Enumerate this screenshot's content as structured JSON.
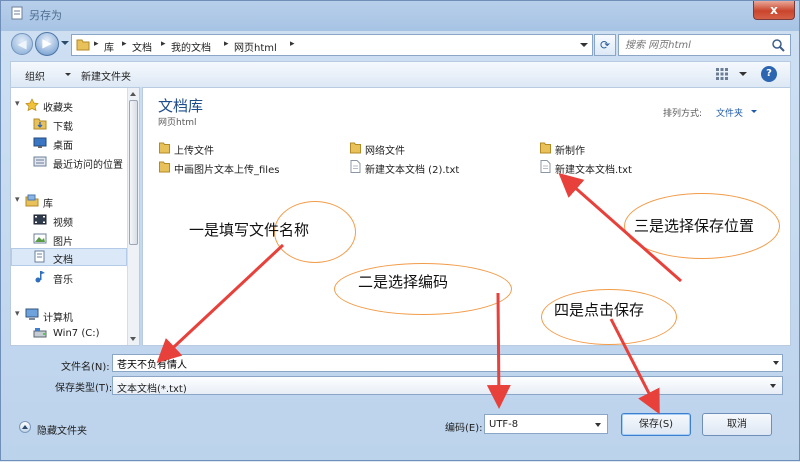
{
  "window": {
    "title": "另存为",
    "close_label": "x"
  },
  "address": {
    "crumbs": [
      "库",
      "文档",
      "我的文档",
      "网页html"
    ],
    "search_placeholder": "搜索 网页html"
  },
  "toolbar": {
    "organize": "组织",
    "new_folder": "新建文件夹",
    "help": "?"
  },
  "nav": {
    "favorites": "收藏夹",
    "downloads": "下载",
    "desktop": "桌面",
    "recent": "最近访问的位置",
    "libraries": "库",
    "videos": "视频",
    "pictures": "图片",
    "documents": "文档",
    "music": "音乐",
    "computer": "计算机",
    "drive_c": "Win7 (C:)"
  },
  "content": {
    "library_title": "文档库",
    "library_subtitle": "网页html",
    "arrange_label": "排列方式:",
    "arrange_value": "文件夹",
    "files": [
      {
        "name": "上传文件",
        "type": "folder"
      },
      {
        "name": "网络文件",
        "type": "folder"
      },
      {
        "name": "新制作",
        "type": "folder"
      },
      {
        "name": "中画图片文本上传_files",
        "type": "folder"
      },
      {
        "name": "新建文本文档 (2).txt",
        "type": "txt"
      },
      {
        "name": "新建文本文档.txt",
        "type": "txt"
      }
    ]
  },
  "annotations": {
    "one": "一是填写文件名称",
    "two": "二是选择编码",
    "three": "三是选择保存位置",
    "four": "四是点击保存"
  },
  "form": {
    "filename_label": "文件名(N):",
    "filename_value": "苍天不负有情人",
    "filetype_label": "保存类型(T):",
    "filetype_value": "文本文档(*.txt)",
    "hide_folders": "隐藏文件夹",
    "encoding_label": "编码(E):",
    "encoding_value": "UTF-8",
    "save": "保存(S)",
    "cancel": "取消"
  },
  "colors": {
    "annotation_arrow": "#e8403a",
    "annotation_bubble": "#f29c4a",
    "library_title": "#1e4d8c"
  }
}
